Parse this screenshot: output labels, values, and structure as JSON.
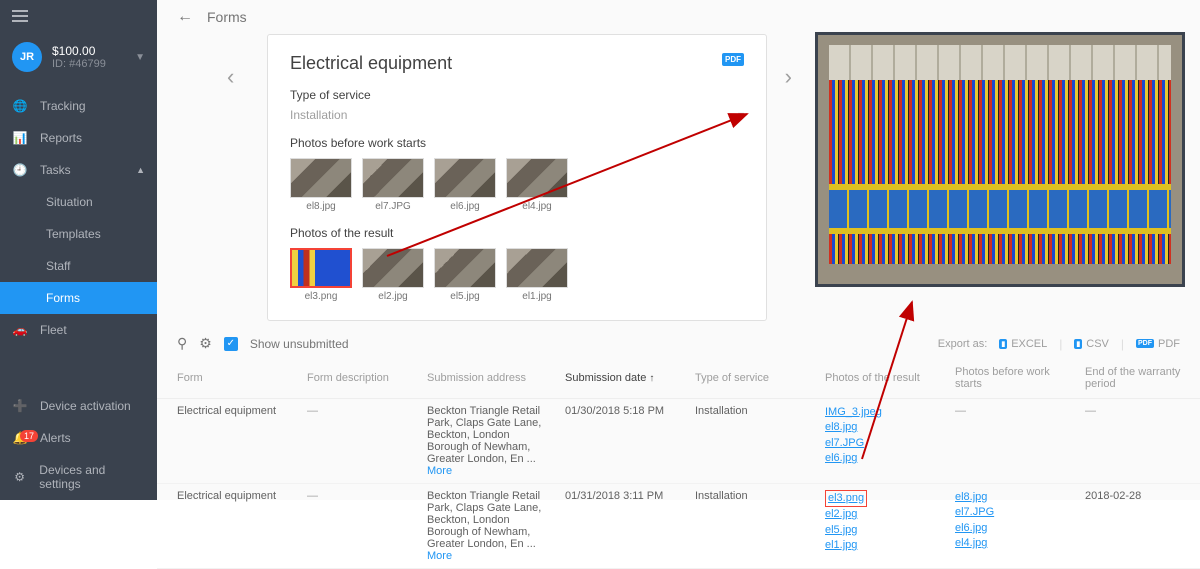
{
  "user": {
    "initials": "JR",
    "balance": "$100.00",
    "id_label": "ID: #46799"
  },
  "sidebar": {
    "tracking": "Tracking",
    "reports": "Reports",
    "tasks": "Tasks",
    "situation": "Situation",
    "templates": "Templates",
    "staff": "Staff",
    "forms": "Forms",
    "fleet": "Fleet",
    "device_activation": "Device activation",
    "alerts": "Alerts",
    "alerts_badge": "17",
    "devices_settings": "Devices and settings"
  },
  "topbar": {
    "title": "Forms"
  },
  "form": {
    "title": "Electrical equipment",
    "type_label": "Type of service",
    "type_value": "Installation",
    "before_label": "Photos before work starts",
    "before_thumbs": [
      "el8.jpg",
      "el7.JPG",
      "el6.jpg",
      "el4.jpg"
    ],
    "result_label": "Photos of the result",
    "result_thumbs": [
      "el3.png",
      "el2.jpg",
      "el5.jpg",
      "el1.jpg"
    ]
  },
  "toolbar": {
    "show_unsubmitted": "Show unsubmitted",
    "export_as": "Export as:",
    "excel": "EXCEL",
    "csv": "CSV",
    "pdf": "PDF"
  },
  "table": {
    "headers": {
      "form": "Form",
      "desc": "Form description",
      "address": "Submission address",
      "date": "Submission date",
      "service": "Type of service",
      "result": "Photos of the result",
      "before": "Photos before work starts",
      "warranty": "End of the warranty period"
    },
    "address_text": "Beckton Triangle Retail Park, Claps Gate Lane, Beckton, London Borough of Newham, Greater London, En ... ",
    "more": "More",
    "rows": [
      {
        "form": "Electrical equipment",
        "date": "01/30/2018 5:18 PM",
        "service": "Installation",
        "result_links": [
          "IMG_3.jpeg",
          "el8.jpg",
          "el7.JPG",
          "el6.jpg"
        ],
        "before_dash": "—",
        "warranty_dash": "—"
      },
      {
        "form": "Electrical equipment",
        "date": "01/31/2018 3:11 PM",
        "service": "Installation",
        "result_links": [
          "el3.png",
          "el2.jpg",
          "el5.jpg",
          "el1.jpg"
        ],
        "before_links": [
          "el8.jpg",
          "el7.JPG",
          "el6.jpg",
          "el4.jpg"
        ],
        "warranty": "2018-02-28"
      }
    ]
  }
}
